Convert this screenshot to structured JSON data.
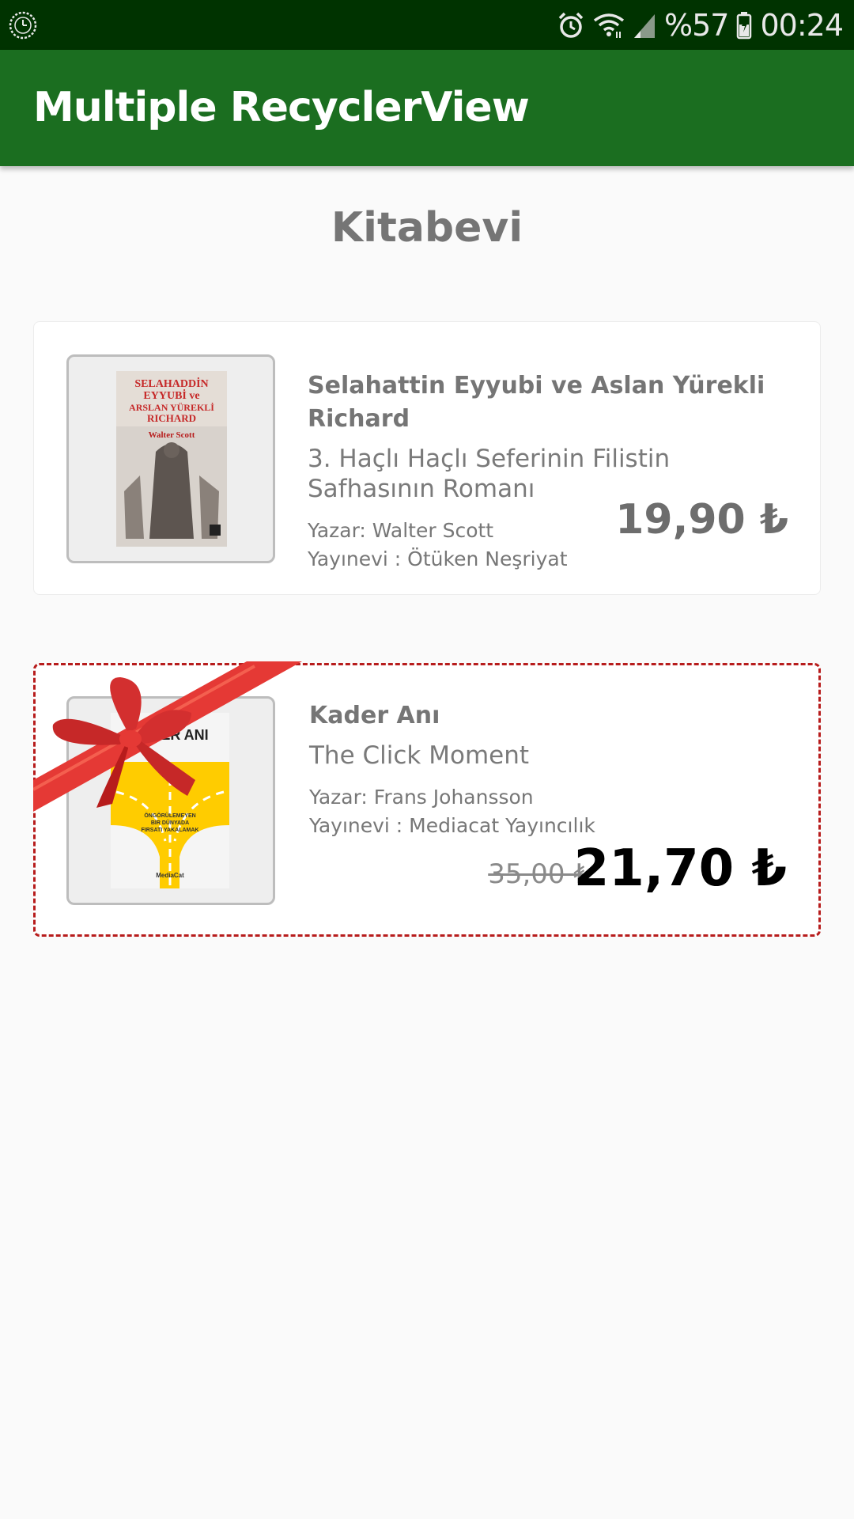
{
  "status_bar": {
    "battery": "%57",
    "time": "00:24",
    "icons": [
      "clock-app-icon",
      "alarm-icon",
      "wifi-icon",
      "signal-icon",
      "battery-icon"
    ]
  },
  "app_bar": {
    "title": "Multiple RecyclerView"
  },
  "page": {
    "heading": "Kitabevi"
  },
  "books": [
    {
      "title": "Selahattin Eyyubi ve Aslan Yürekli Richard",
      "subtitle": "3. Haçlı Haçlı Seferinin Filistin Safhasının Romanı",
      "author": "Yazar: Walter Scott",
      "publisher": "Yayınevi : Ötüken Neşriyat",
      "price": "19,90 ₺",
      "cover_lines": [
        "SELAHADDİN",
        "EYYUBİ ve",
        "ARSLAN YÜREKLİ",
        "RICHARD",
        "Walter Scott"
      ]
    },
    {
      "title": "Kader Anı",
      "subtitle": "The Click Moment",
      "author": "Yazar: Frans Johansson",
      "publisher": "Yayınevi : Mediacat Yayıncılık",
      "old_price": "35,00 ₺",
      "price": "21,70 ₺",
      "cover_lines": [
        "DER ANI",
        "ÖNGÖRÜLEMEYEN",
        "BİR DÜNYADA",
        "FIRSATI YAKALAMAK",
        "MediaCat"
      ]
    }
  ],
  "colors": {
    "status_bar": "#003300",
    "app_bar": "#1b6e20",
    "promo_border": "#b71c1c",
    "ribbon": "#e53935"
  }
}
